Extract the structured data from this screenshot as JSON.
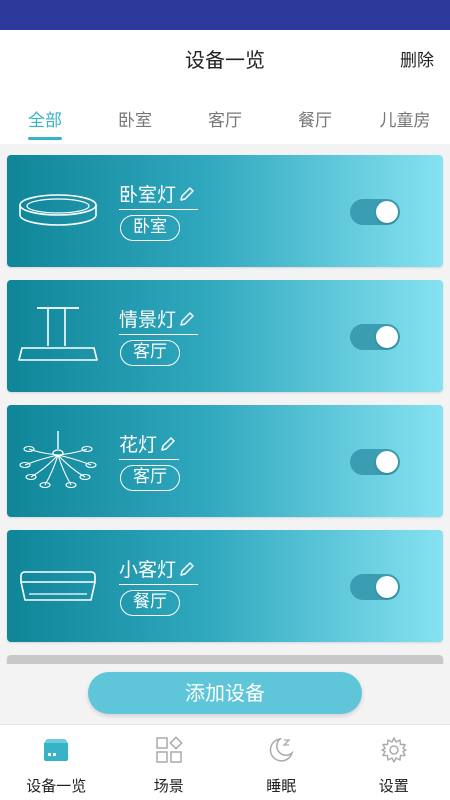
{
  "header": {
    "title": "设备一览",
    "action": "删除"
  },
  "tabs": [
    {
      "label": "全部",
      "active": true
    },
    {
      "label": "卧室",
      "active": false
    },
    {
      "label": "客厅",
      "active": false
    },
    {
      "label": "餐厅",
      "active": false
    },
    {
      "label": "儿童房",
      "active": false
    }
  ],
  "devices": [
    {
      "name": "卧室灯",
      "room": "卧室",
      "icon": "ceiling-lamp-round-icon",
      "on": true
    },
    {
      "name": "情景灯",
      "room": "客厅",
      "icon": "pendant-lamp-icon",
      "on": true
    },
    {
      "name": "花灯",
      "room": "客厅",
      "icon": "chandelier-icon",
      "on": true
    },
    {
      "name": "小客灯",
      "room": "餐厅",
      "icon": "ceiling-lamp-square-icon",
      "on": true
    }
  ],
  "add_button": "添加设备",
  "bottom_nav": [
    {
      "label": "设备一览",
      "icon": "device-list-icon",
      "active": true
    },
    {
      "label": "场景",
      "icon": "scene-grid-icon",
      "active": false
    },
    {
      "label": "睡眠",
      "icon": "moon-sleep-icon",
      "active": false
    },
    {
      "label": "设置",
      "icon": "gear-icon",
      "active": false
    }
  ],
  "colors": {
    "status_bar": "#2e3a9b",
    "accent": "#37b3c8",
    "card_start": "#0f8598",
    "card_end": "#86e2f1",
    "toggle_on": "#3a9db2"
  }
}
